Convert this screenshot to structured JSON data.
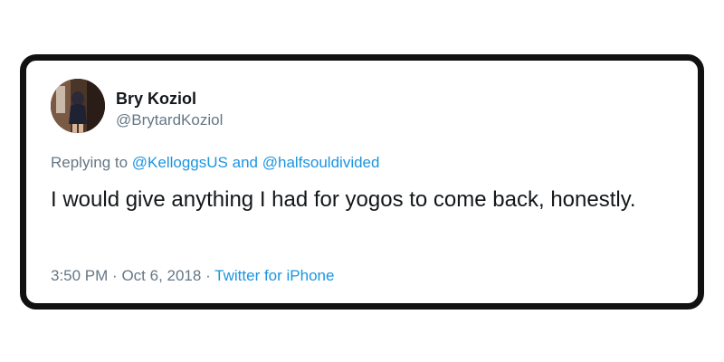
{
  "tweet": {
    "author": {
      "name": "Bry Koziol",
      "handle": "@BrytardKoziol"
    },
    "reply": {
      "prefix": "Replying to",
      "mention1": "@KelloggsUS",
      "conjunction": "and",
      "mention2": "@halfsouldivided"
    },
    "text": "I would give anything I had for yogos to come back, honestly.",
    "meta": {
      "time": "3:50 PM",
      "separator": "·",
      "date": "Oct 6, 2018",
      "source": "Twitter for iPhone"
    }
  },
  "colors": {
    "link": "#1b95e0",
    "secondary_text": "#657786",
    "primary_text": "#14171a",
    "card_border": "#111111"
  }
}
